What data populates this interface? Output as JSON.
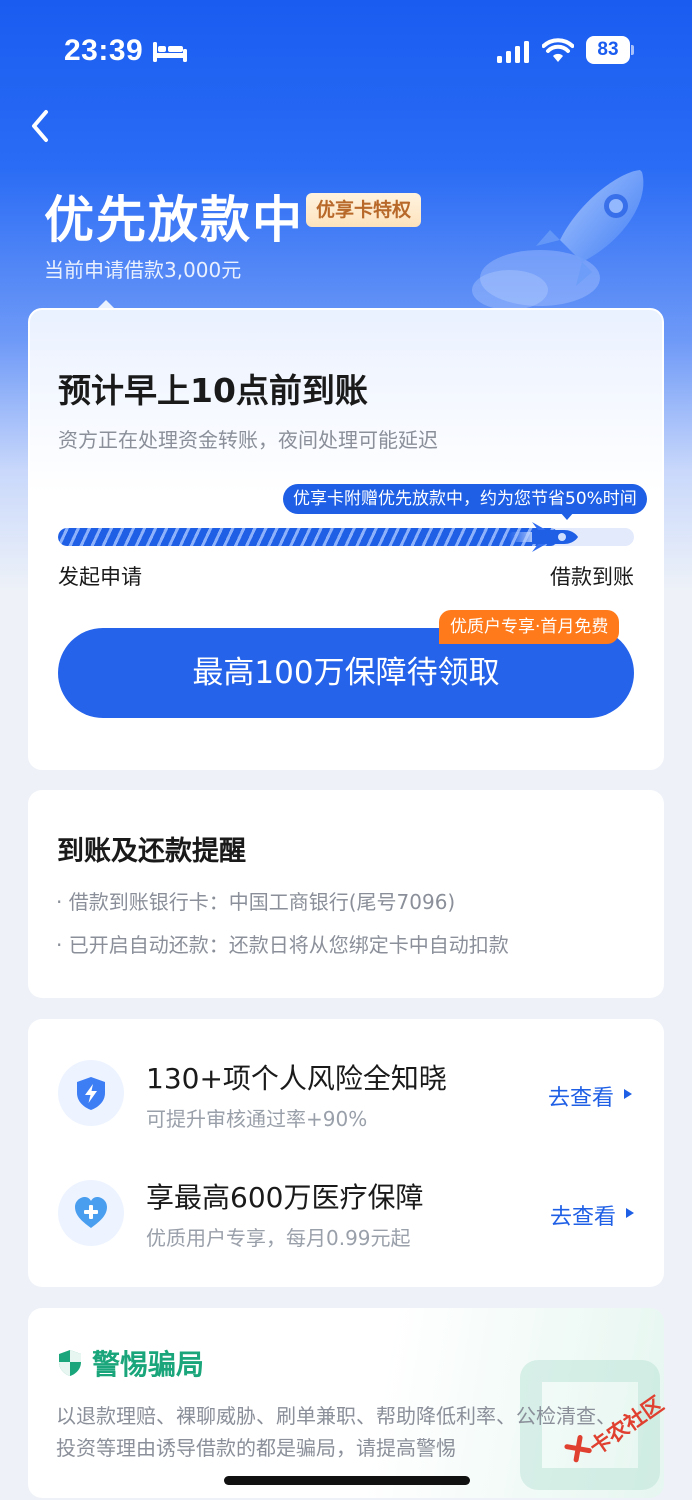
{
  "status_bar": {
    "time": "23:39",
    "battery": "83",
    "icons": [
      "bed-icon",
      "signal-icon",
      "wifi-icon",
      "battery-icon"
    ]
  },
  "header": {
    "title": "优先放款中",
    "badge": "优享卡特权",
    "subtitle": "当前申请借款3,000元",
    "back_icon": "chevron-left-icon"
  },
  "progress_card": {
    "title": "预计早上10点前到账",
    "description": "资方正在处理资金转账，夜间处理可能延迟",
    "tooltip": "优享卡附赠优先放款中，约为您节省50%时间",
    "progress": 0.87,
    "start_label": "发起申请",
    "end_label": "借款到账",
    "cta_label": "最高100万保障待领取",
    "cta_badge": "优质户专享·首月免费"
  },
  "reminder_card": {
    "title": "到账及还款提醒",
    "items": [
      "· 借款到账银行卡：中国工商银行(尾号7096)",
      "· 已开启自动还款：还款日将从您绑定卡中自动扣款"
    ]
  },
  "services": [
    {
      "icon": "shield-lightning-icon",
      "title": "130+项个人风险全知晓",
      "subtitle": "可提升审核通过率+90%",
      "link": "去查看"
    },
    {
      "icon": "heart-plus-icon",
      "title": "享最高600万医疗保障",
      "subtitle": "优质用户专享，每月0.99元起",
      "link": "去查看"
    }
  ],
  "warning_card": {
    "title": "警惕骗局",
    "body": "以退款理赔、裸聊威胁、刷单兼职、帮助降低利率、公检清查、投资等理由诱导借款的都是骗局，请提高警惕"
  },
  "watermark": "卡农社区",
  "colors": {
    "brand_blue": "#2563eb",
    "accent_orange": "#ff7a1a",
    "warning_green": "#1aa67a"
  }
}
